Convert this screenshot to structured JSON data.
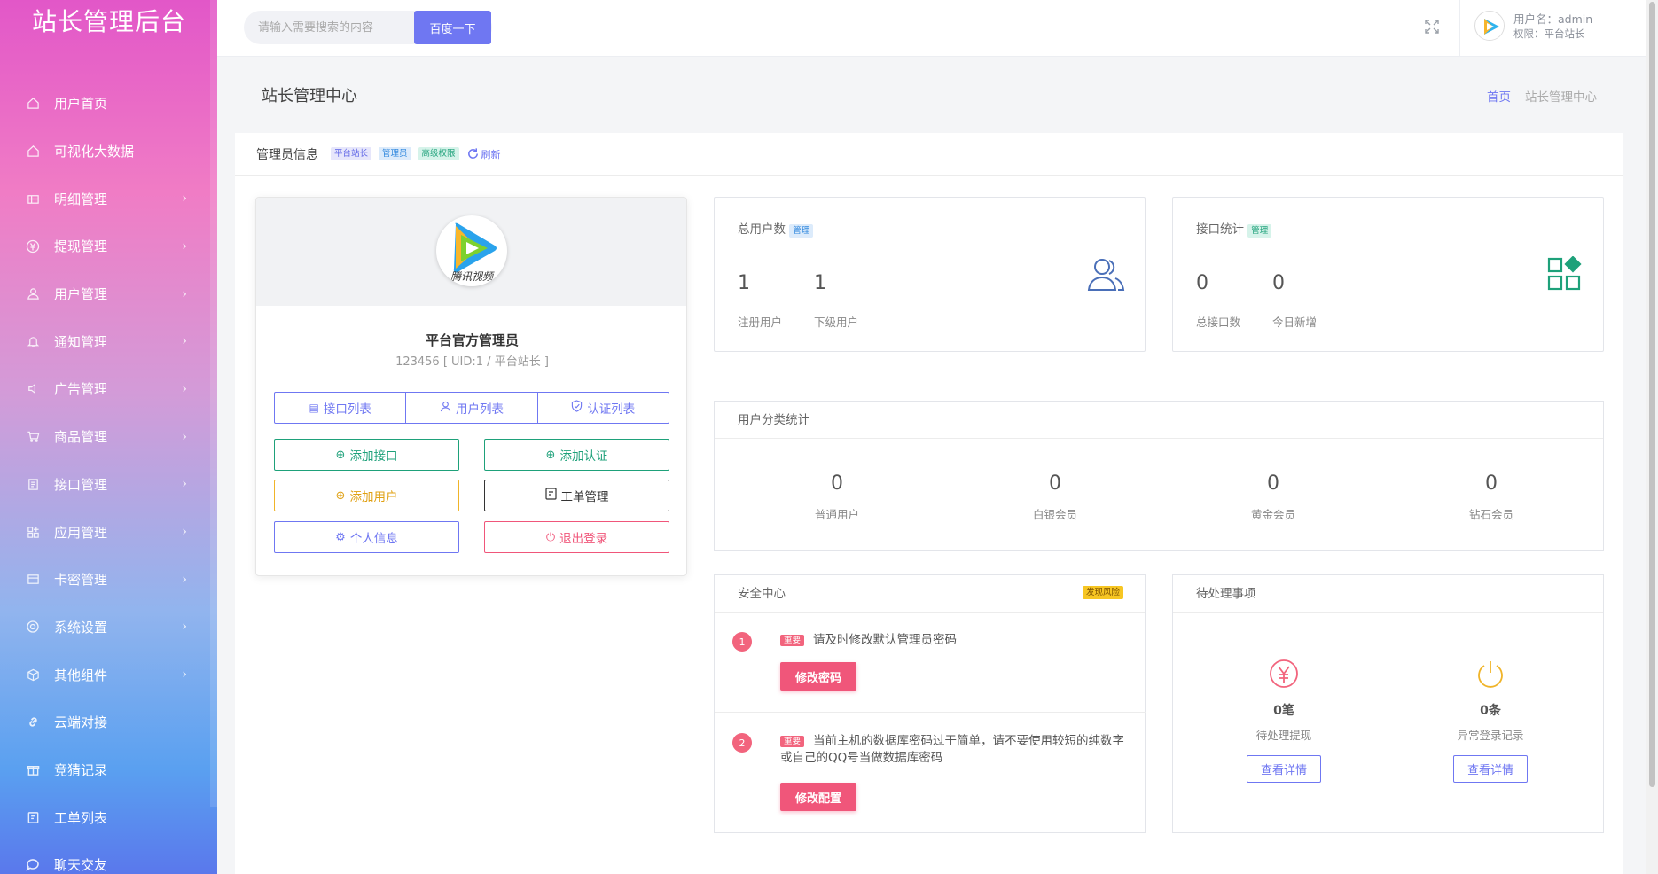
{
  "sidebar": {
    "logo": "站长管理后台",
    "items": [
      {
        "label": "用户首页",
        "icon": "home-icon",
        "arrow": false
      },
      {
        "label": "可视化大数据",
        "icon": "home-icon",
        "arrow": false
      },
      {
        "label": "明细管理",
        "icon": "table-icon",
        "arrow": true
      },
      {
        "label": "提现管理",
        "icon": "yen-icon",
        "arrow": true
      },
      {
        "label": "用户管理",
        "icon": "user-icon",
        "arrow": true
      },
      {
        "label": "通知管理",
        "icon": "bell-icon",
        "arrow": true
      },
      {
        "label": "广告管理",
        "icon": "speaker-icon",
        "arrow": true
      },
      {
        "label": "商品管理",
        "icon": "cart-icon",
        "arrow": true
      },
      {
        "label": "接口管理",
        "icon": "api-icon",
        "arrow": true
      },
      {
        "label": "应用管理",
        "icon": "apps-icon",
        "arrow": true
      },
      {
        "label": "卡密管理",
        "icon": "card-icon",
        "arrow": true
      },
      {
        "label": "系统设置",
        "icon": "gear-icon",
        "arrow": true
      },
      {
        "label": "其他组件",
        "icon": "cube-icon",
        "arrow": true
      },
      {
        "label": "云端对接",
        "icon": "link-icon",
        "arrow": false
      },
      {
        "label": "竞猜记录",
        "icon": "gift-icon",
        "arrow": false
      },
      {
        "label": "工单列表",
        "icon": "ticket-icon",
        "arrow": false
      },
      {
        "label": "聊天交友",
        "icon": "chat-icon",
        "arrow": false
      }
    ]
  },
  "header": {
    "search_placeholder": "请输入需要搜索的内容",
    "search_button": "百度一下",
    "user_name": "用户名：admin",
    "user_role": "权限：平台站长"
  },
  "page": {
    "title": "站长管理中心",
    "breadcrumb_home": "首页",
    "breadcrumb_current": "站长管理中心"
  },
  "admin_info": {
    "title": "管理员信息",
    "tags": [
      "平台站长",
      "管理员",
      "高级权限"
    ],
    "refresh": "刷新"
  },
  "profile": {
    "avatar_text": "腾讯视频",
    "name": "平台官方管理员",
    "uid": "123456 [ UID:1 / 平台站长 ]",
    "seg_buttons": [
      "接口列表",
      "用户列表",
      "认证列表"
    ],
    "actions": {
      "add_api": "添加接口",
      "add_auth": "添加认证",
      "add_user": "添加用户",
      "ticket": "工单管理",
      "profile": "个人信息",
      "logout": "退出登录"
    }
  },
  "total_users": {
    "label": "总用户数",
    "tag": "管理",
    "values": [
      {
        "num": "1",
        "label": "注册用户"
      },
      {
        "num": "1",
        "label": "下级用户"
      }
    ]
  },
  "api_stats": {
    "label": "接口统计",
    "tag": "管理",
    "values": [
      {
        "num": "0",
        "label": "总接口数"
      },
      {
        "num": "0",
        "label": "今日新增"
      }
    ]
  },
  "user_category": {
    "title": "用户分类统计",
    "items": [
      {
        "num": "0",
        "label": "普通用户"
      },
      {
        "num": "0",
        "label": "白银会员"
      },
      {
        "num": "0",
        "label": "黄金会员"
      },
      {
        "num": "0",
        "label": "钻石会员"
      }
    ]
  },
  "security": {
    "title": "安全中心",
    "badge": "发现风险",
    "important": "重要",
    "items": [
      {
        "no": "1",
        "text": "请及时修改默认管理员密码",
        "button": "修改密码"
      },
      {
        "no": "2",
        "text": "当前主机的数据库密码过于简单，请不要使用较短的纯数字或自己的QQ号当做数据库密码",
        "button": "修改配置"
      }
    ]
  },
  "pending": {
    "title": "待处理事项",
    "items": [
      {
        "num": "0笔",
        "label": "待处理提现",
        "button": "查看详情",
        "color": "#f2647d"
      },
      {
        "num": "0条",
        "label": "异常登录记录",
        "button": "查看详情",
        "color": "#f0b429"
      }
    ]
  },
  "colors": {
    "accent": "#6f77f2",
    "green": "#1ea17a",
    "red": "#f0567a",
    "yellow": "#f0b429"
  }
}
